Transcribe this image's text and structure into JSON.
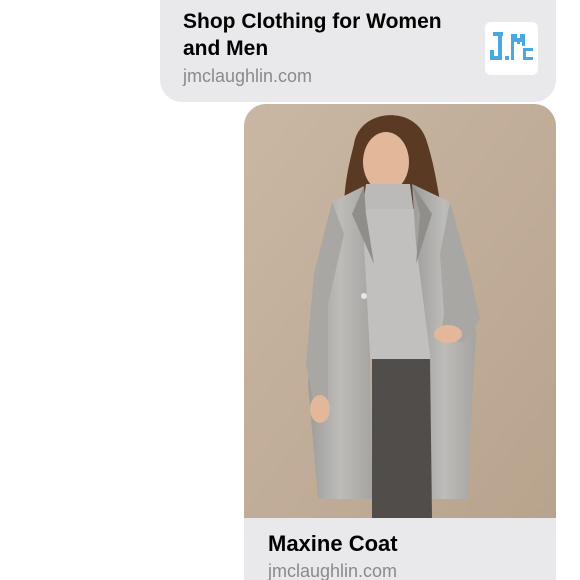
{
  "messages": [
    {
      "title": "Shop Clothing for Women and Men",
      "domain": "jmclaughlin.com",
      "icon": "jmc-logo-icon",
      "icon_text": "J.Mc"
    },
    {
      "title": "Maxine Coat",
      "domain": "jmclaughlin.com",
      "image": "product-photo"
    }
  ],
  "colors": {
    "bubble": "#e9e9eb",
    "secondary_text": "#8a8a8e",
    "logo": "#4aa8e0"
  }
}
